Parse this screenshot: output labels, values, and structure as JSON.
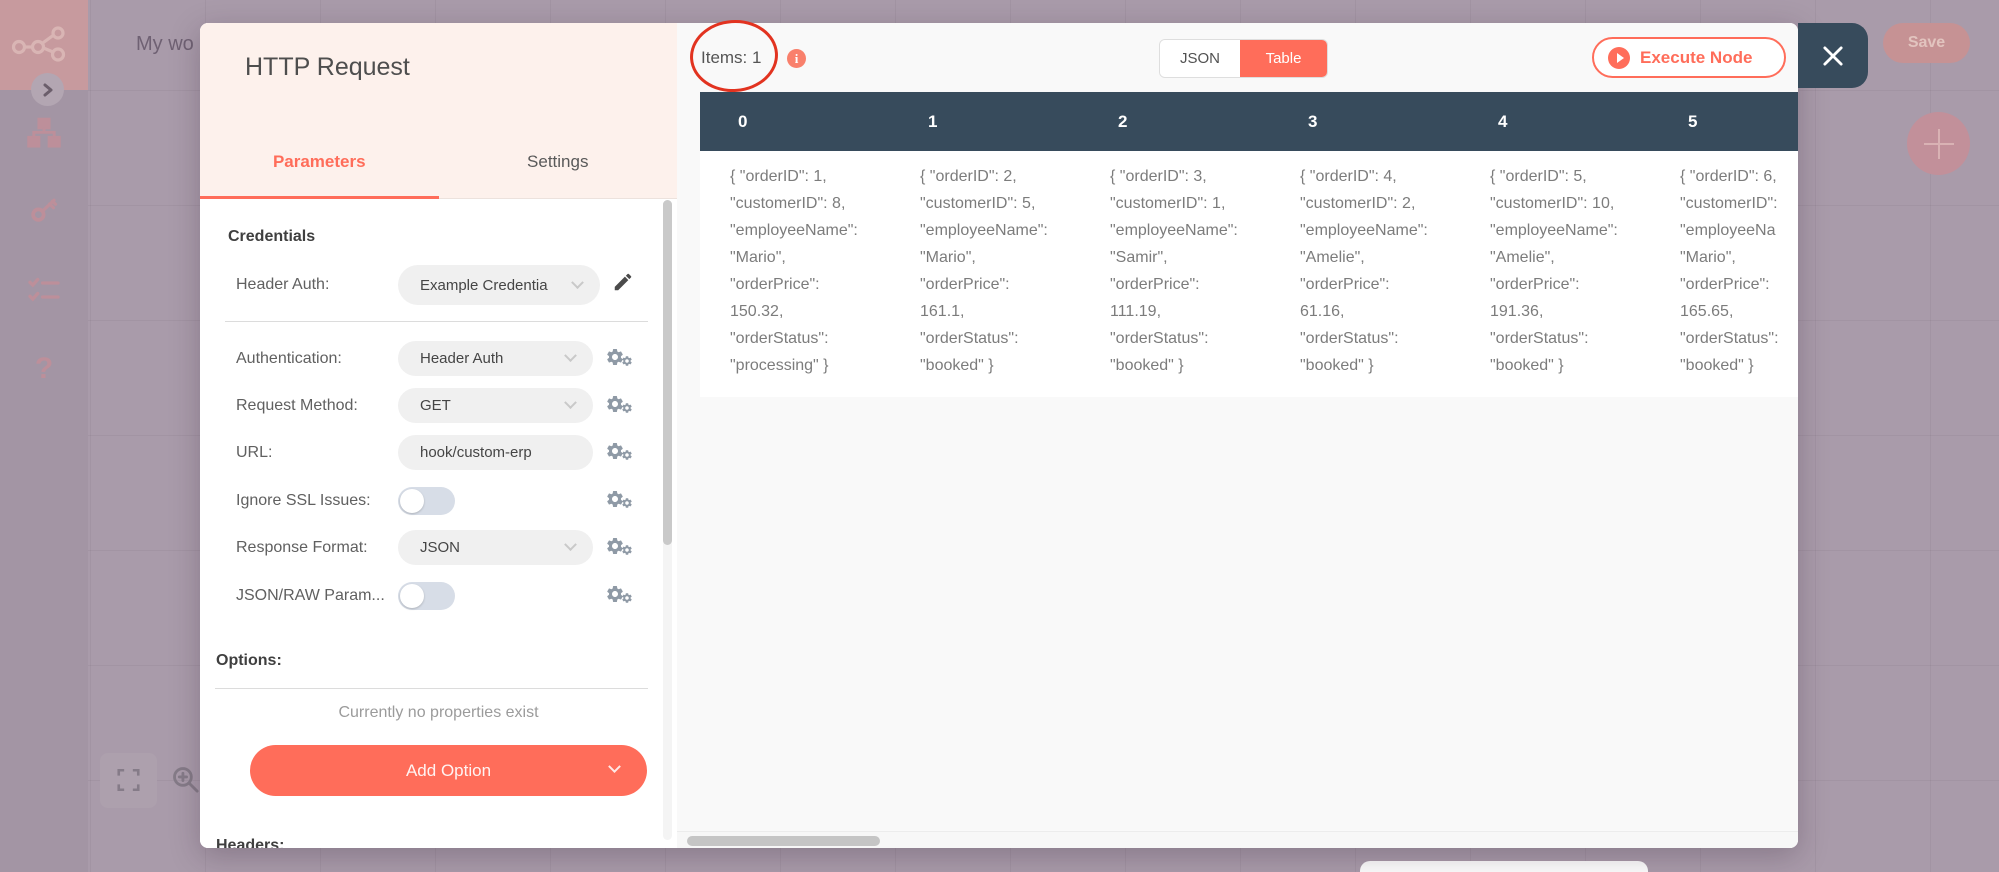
{
  "colors": {
    "accent": "#ff6d5a",
    "table_header": "#374b5c",
    "annotation": "#e23320",
    "info_icon": "#f9806c",
    "modal_header_bg": "#fdf1ec"
  },
  "canvas": {
    "workflow_title": "My wo",
    "save_label": "Save",
    "sidebar_icons": [
      "n8n-logo",
      "collapse-chevron",
      "workflows-icon",
      "credentials-key-icon",
      "executions-list-icon",
      "help-icon"
    ],
    "canvas_controls": [
      "fullscreen-icon",
      "zoom-in-icon",
      "add-node-plus-button"
    ]
  },
  "modal": {
    "title": "HTTP Request",
    "tabs": [
      {
        "label": "Parameters",
        "active": true
      },
      {
        "label": "Settings",
        "active": false
      }
    ],
    "credentials": {
      "section_label": "Credentials",
      "label": "Header Auth:",
      "value": "Example Credentia"
    },
    "parameters": [
      {
        "label": "Authentication:",
        "type": "select",
        "value": "Header Auth"
      },
      {
        "label": "Request Method:",
        "type": "select",
        "value": "GET"
      },
      {
        "label": "URL:",
        "type": "input",
        "value": "hook/custom-erp"
      },
      {
        "label": "Ignore SSL Issues:",
        "type": "toggle",
        "value": false
      },
      {
        "label": "Response Format:",
        "type": "select",
        "value": "JSON"
      },
      {
        "label": "JSON/RAW Param...",
        "type": "toggle",
        "value": false
      }
    ],
    "options": {
      "label": "Options:",
      "empty_text": "Currently no properties exist",
      "add_button_label": "Add Option"
    },
    "headers_label": "Headers:"
  },
  "results": {
    "items_label": "Items: 1",
    "view_toggle": {
      "json_label": "JSON",
      "table_label": "Table",
      "active": "Table"
    },
    "execute_button_label": "Execute Node",
    "table": {
      "columns": [
        "0",
        "1",
        "2",
        "3",
        "4",
        "5"
      ],
      "cells": [
        [
          "{ \"orderID\": 1,",
          "\"customerID\": 8,",
          "\"employeeName\":",
          "\"Mario\",",
          "\"orderPrice\":",
          "150.32,",
          "\"orderStatus\":",
          "\"processing\" }"
        ],
        [
          "{ \"orderID\": 2,",
          "\"customerID\": 5,",
          "\"employeeName\":",
          "\"Mario\",",
          "\"orderPrice\":",
          "161.1,",
          "\"orderStatus\":",
          "\"booked\" }"
        ],
        [
          "{ \"orderID\": 3,",
          "\"customerID\": 1,",
          "\"employeeName\":",
          "\"Samir\",",
          "\"orderPrice\":",
          "111.19,",
          "\"orderStatus\":",
          "\"booked\" }"
        ],
        [
          "{ \"orderID\": 4,",
          "\"customerID\": 2,",
          "\"employeeName\":",
          "\"Amelie\",",
          "\"orderPrice\":",
          "61.16,",
          "\"orderStatus\":",
          "\"booked\" }"
        ],
        [
          "{ \"orderID\": 5,",
          "\"customerID\": 10,",
          "\"employeeName\":",
          "\"Amelie\",",
          "\"orderPrice\":",
          "191.36,",
          "\"orderStatus\":",
          "\"booked\" }"
        ],
        [
          "{ \"orderID\": 6,",
          "\"customerID\":",
          "\"employeeNa",
          "\"Mario\",",
          "\"orderPrice\":",
          "165.65,",
          "\"orderStatus\":",
          "\"booked\" }"
        ]
      ]
    }
  }
}
